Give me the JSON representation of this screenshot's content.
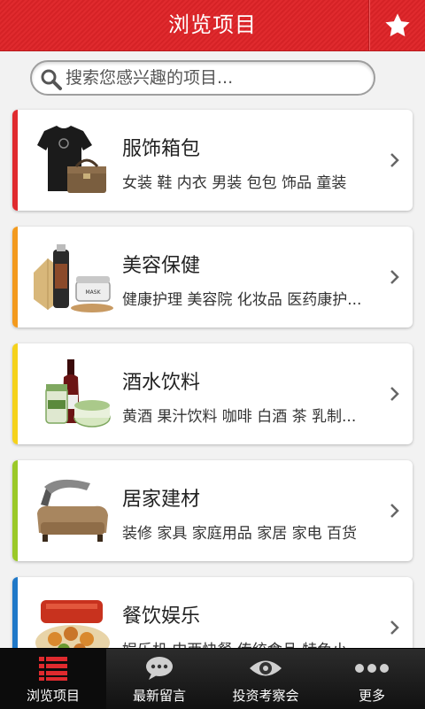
{
  "header": {
    "title": "浏览项目"
  },
  "search": {
    "placeholder": "搜索您感兴趣的项目..."
  },
  "categories": [
    {
      "title": "服饰箱包",
      "tags": "女装 鞋 内衣 男装 包包 饰品 童装",
      "accent": "#e02a2e"
    },
    {
      "title": "美容保健",
      "tags": "健康护理 美容院 化妆品 医药康护...",
      "accent": "#f39a1e"
    },
    {
      "title": "酒水饮料",
      "tags": "黄酒 果汁饮料 咖啡 白酒 茶 乳制...",
      "accent": "#f5d21c"
    },
    {
      "title": "居家建材",
      "tags": "装修 家具 家庭用品 家居 家电 百货",
      "accent": "#9bc928"
    },
    {
      "title": "餐饮娱乐",
      "tags": "娱乐机 中西快餐 传统食品 特色小...",
      "accent": "#1f78c8"
    }
  ],
  "tabs": [
    {
      "label": "浏览项目",
      "icon": "list-icon"
    },
    {
      "label": "最新留言",
      "icon": "chat-bubble-icon"
    },
    {
      "label": "投资考察会",
      "icon": "eye-icon"
    },
    {
      "label": "更多",
      "icon": "more-dots-icon"
    }
  ],
  "colors": {
    "header_red": "#e02a2e",
    "tab_active_icon": "#e02a2e",
    "tabbar_bg": "#1a1a1a"
  }
}
